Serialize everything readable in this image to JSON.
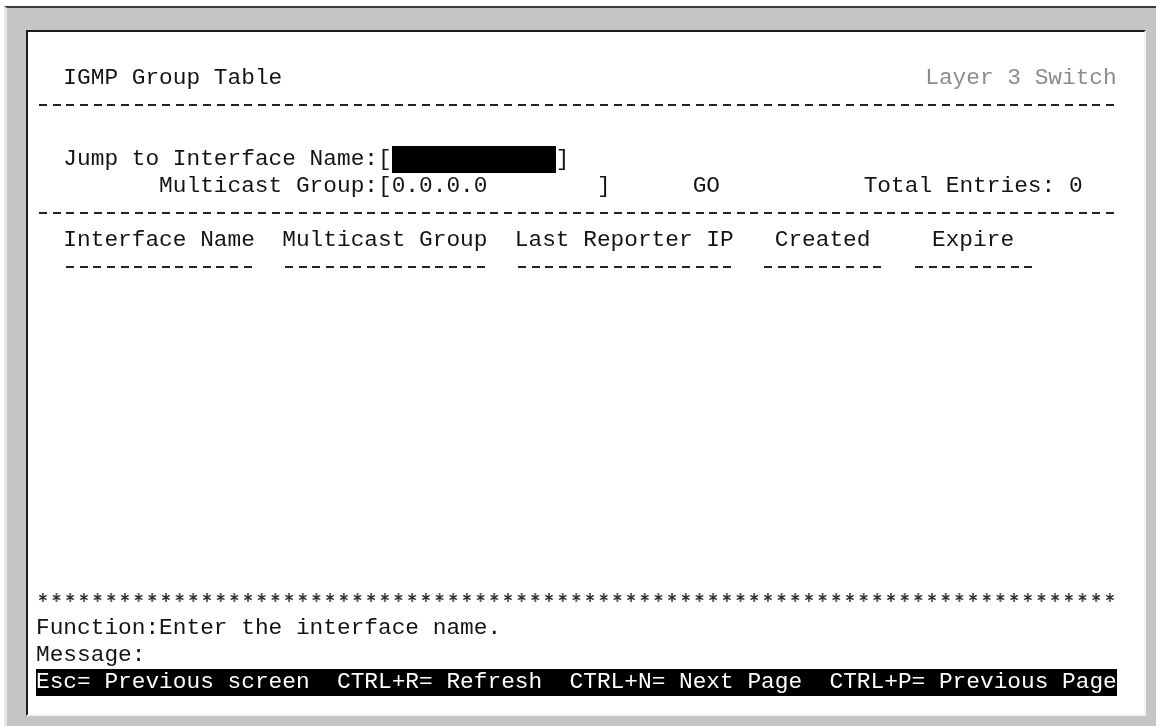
{
  "screen": {
    "title": "IGMP Group Table",
    "device": "Layer 3 Switch"
  },
  "fields": [
    {
      "kind": "name",
      "label": "Jump to Interface Name:",
      "bracket_open": "[",
      "bracket_close": "]",
      "focused": true
    },
    {
      "kind": "ip",
      "label": "Multicast Group:",
      "bracket_open": "[",
      "value": "0.0.0.0",
      "bracket_close": "]",
      "focused": false
    }
  ],
  "go_button": "GO",
  "total_entries": "Total Entries: 0",
  "table": {
    "columns": [
      "Interface Name",
      "Multicast Group",
      "Last Reporter IP",
      "Created",
      "Expire"
    ]
  },
  "function_help": "Function:Enter the interface name.",
  "message_label": "Message:",
  "hotkeys": [
    "Esc= Previous screen",
    "CTRL+R= Refresh",
    "CTRL+N= Next Page",
    "CTRL+P= Previous Page"
  ]
}
